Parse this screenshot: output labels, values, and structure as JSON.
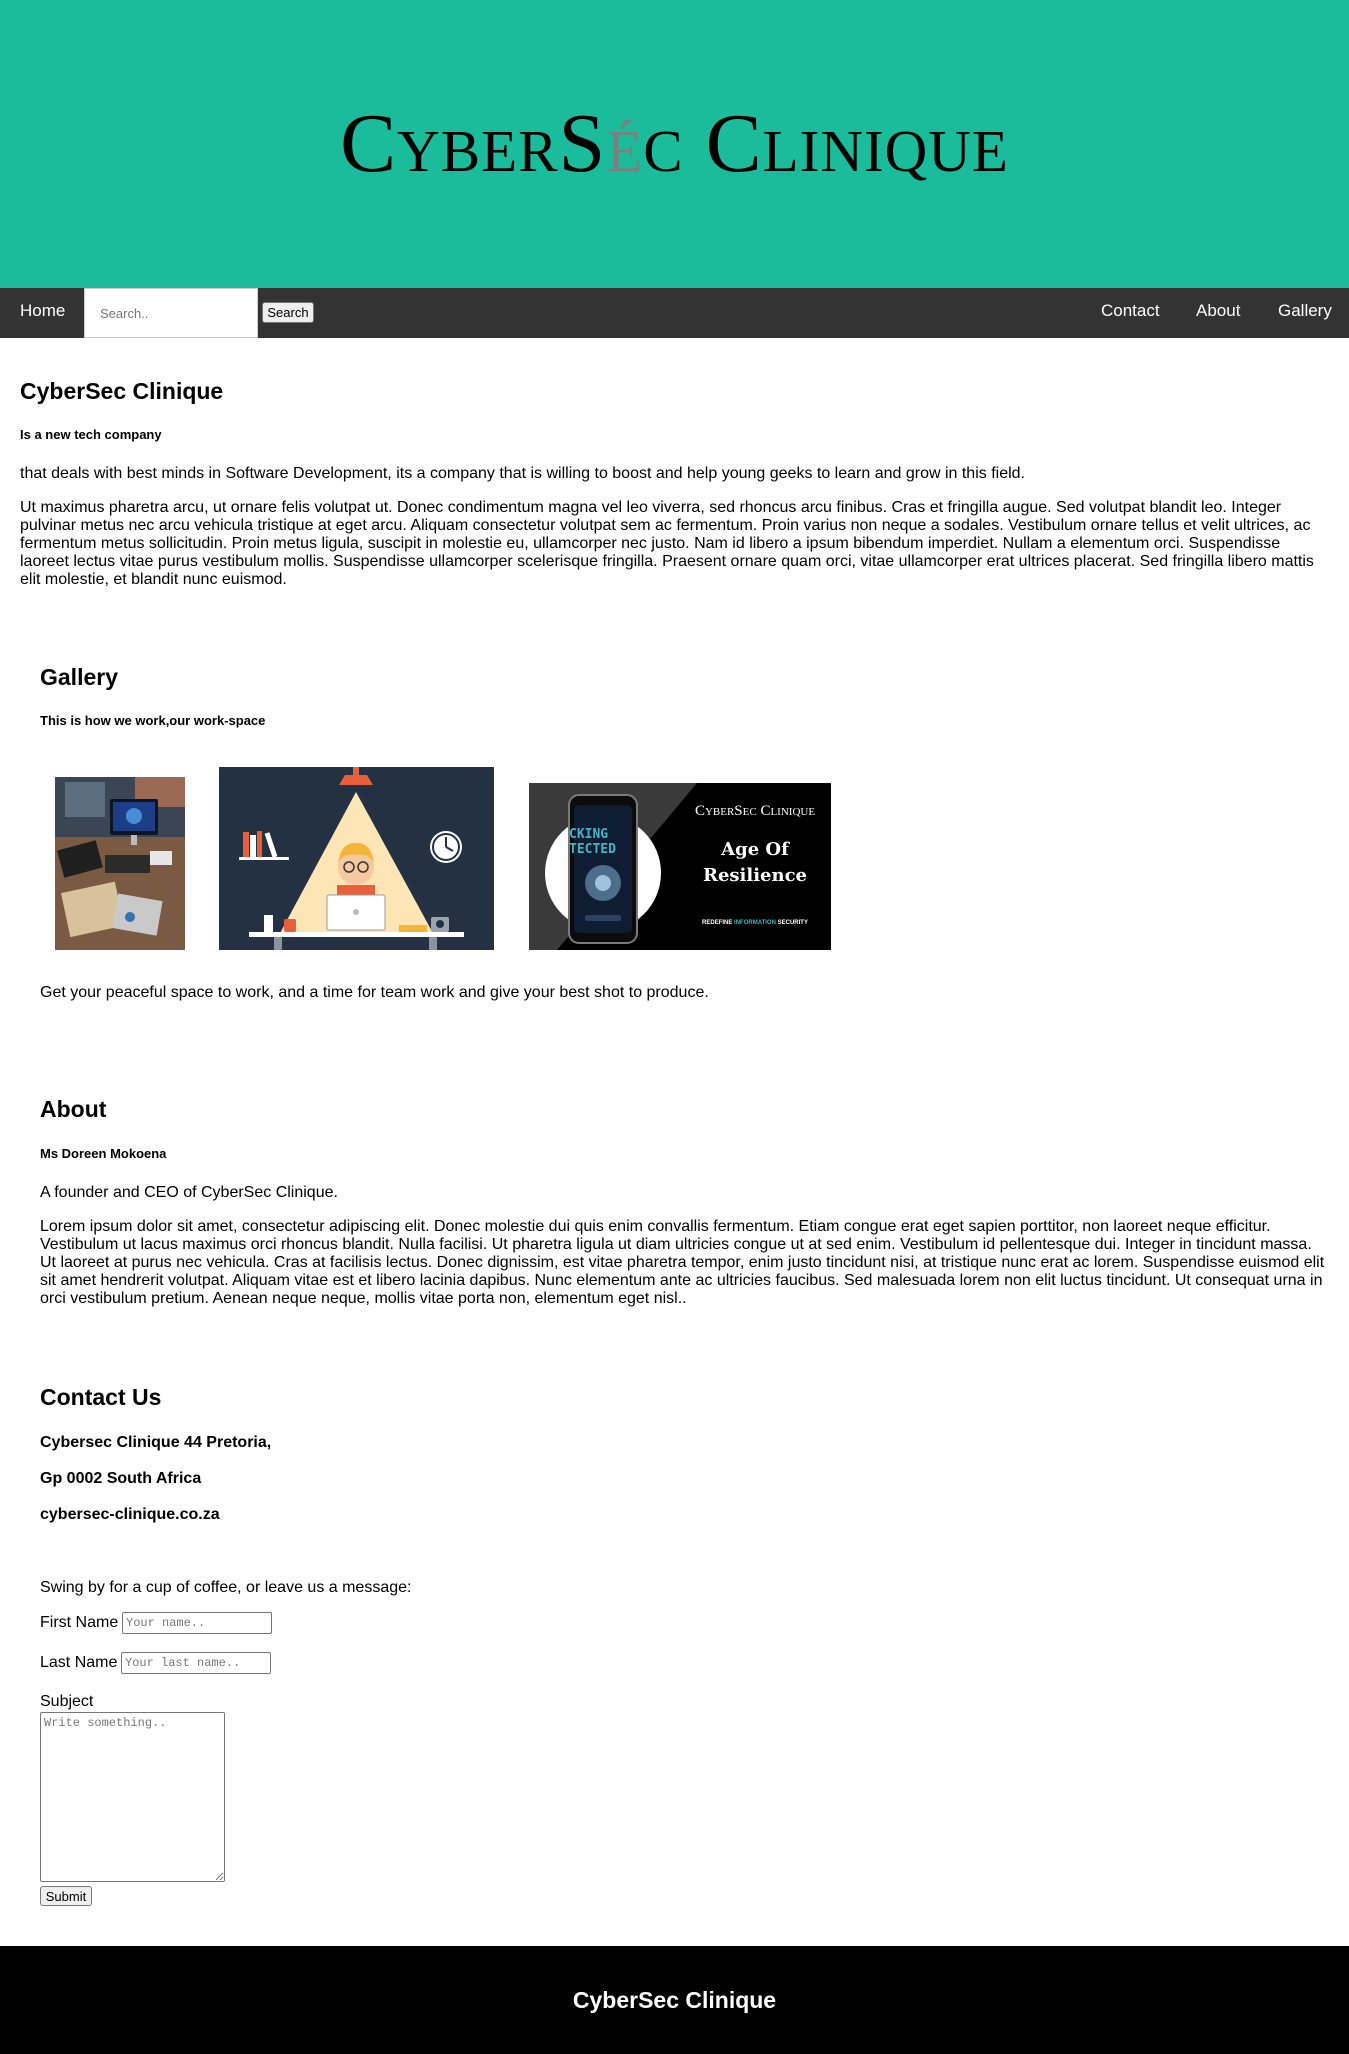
{
  "header": {
    "logo_part1": "CyberS",
    "logo_accent": "é",
    "logo_part2": "c Clinique"
  },
  "nav": {
    "home": "Home",
    "search_placeholder": "Search..",
    "search_button": "Search",
    "contact": "Contact",
    "about": "About",
    "gallery": "Gallery"
  },
  "intro": {
    "title": "CyberSec Clinique",
    "subtitle": "Is a new tech company",
    "paragraph1": "that deals with best minds in Software Development, its a company that is willing to boost and help young geeks to learn and grow in this field.",
    "paragraph2": "Ut maximus pharetra arcu, ut ornare felis volutpat ut. Donec condimentum magna vel leo viverra, sed rhoncus arcu finibus. Cras et fringilla augue. Sed volutpat blandit leo. Integer pulvinar metus nec arcu vehicula tristique at eget arcu. Aliquam consectetur volutpat sem ac fermentum. Proin varius non neque a sodales. Vestibulum ornare tellus et velit ultrices, ac fermentum metus sollicitudin. Proin metus ligula, suscipit in molestie eu, ullamcorper nec justo. Nam id libero a ipsum bibendum imperdiet. Nullam a elementum orci. Suspendisse laoreet lectus vitae purus vestibulum mollis. Suspendisse ullamcorper scelerisque fringilla. Praesent ornare quam orci, vitae ullamcorper erat ultrices placerat. Sed fringilla libero mattis elit molestie, et blandit nunc euismod."
  },
  "gallery": {
    "title": "Gallery",
    "subtitle": "This is how we work,our work-space",
    "banner": {
      "brand": "CyberSec Clinique",
      "headline_line1": "Age Of",
      "headline_line2": "Resilience",
      "phone_text_line1": "CKING",
      "phone_text_line2": "TECTED",
      "tagline_start": "REDEFINE ",
      "tagline_accent": "INFORMATION",
      "tagline_end": " SECURITY",
      "accent_color": "#3fb6c8"
    },
    "caption": "Get your peaceful space to work, and a time for team work and give your best shot to produce."
  },
  "about": {
    "title": "About",
    "name": "Ms Doreen Mokoena",
    "role": "A founder and CEO of CyberSec Clinique.",
    "bio": "Lorem ipsum dolor sit amet, consectetur adipiscing elit. Donec molestie dui quis enim convallis fermentum. Etiam congue erat eget sapien porttitor, non laoreet neque efficitur. Vestibulum ut lacus maximus orci rhoncus blandit. Nulla facilisi. Ut pharetra ligula ut diam ultricies congue ut at sed enim. Vestibulum id pellentesque dui. Integer in tincidunt massa. Ut laoreet at purus nec vehicula. Cras at facilisis lectus. Donec dignissim, est vitae pharetra tempor, enim justo tincidunt nisi, at tristique nunc erat ac lorem. Suspendisse euismod elit sit amet hendrerit volutpat. Aliquam vitae est et libero lacinia dapibus. Nunc elementum ante ac ultricies faucibus. Sed malesuada lorem non elit luctus tincidunt. Ut consequat urna in orci vestibulum pretium. Aenean neque neque, mollis vitae porta non, elementum eget nisl.."
  },
  "contact": {
    "title": "Contact Us",
    "address_line1": "Cybersec Clinique 44 Pretoria,",
    "address_line2": "Gp 0002 South Africa",
    "website": "cybersec-clinique.co.za",
    "intro": "Swing by for a cup of coffee, or leave us a message:",
    "form": {
      "first_name_label": "First Name",
      "first_name_placeholder": "Your name..",
      "last_name_label": "Last Name",
      "last_name_placeholder": "Your last name..",
      "subject_label": "Subject",
      "subject_placeholder": "Write something..",
      "submit_label": "Submit"
    }
  },
  "footer": {
    "title": "CyberSec Clinique"
  },
  "colors": {
    "header_bg": "#1abc9c",
    "nav_bg": "#333333",
    "footer_bg": "#000000",
    "logo_accent": "#7f7f7f"
  }
}
